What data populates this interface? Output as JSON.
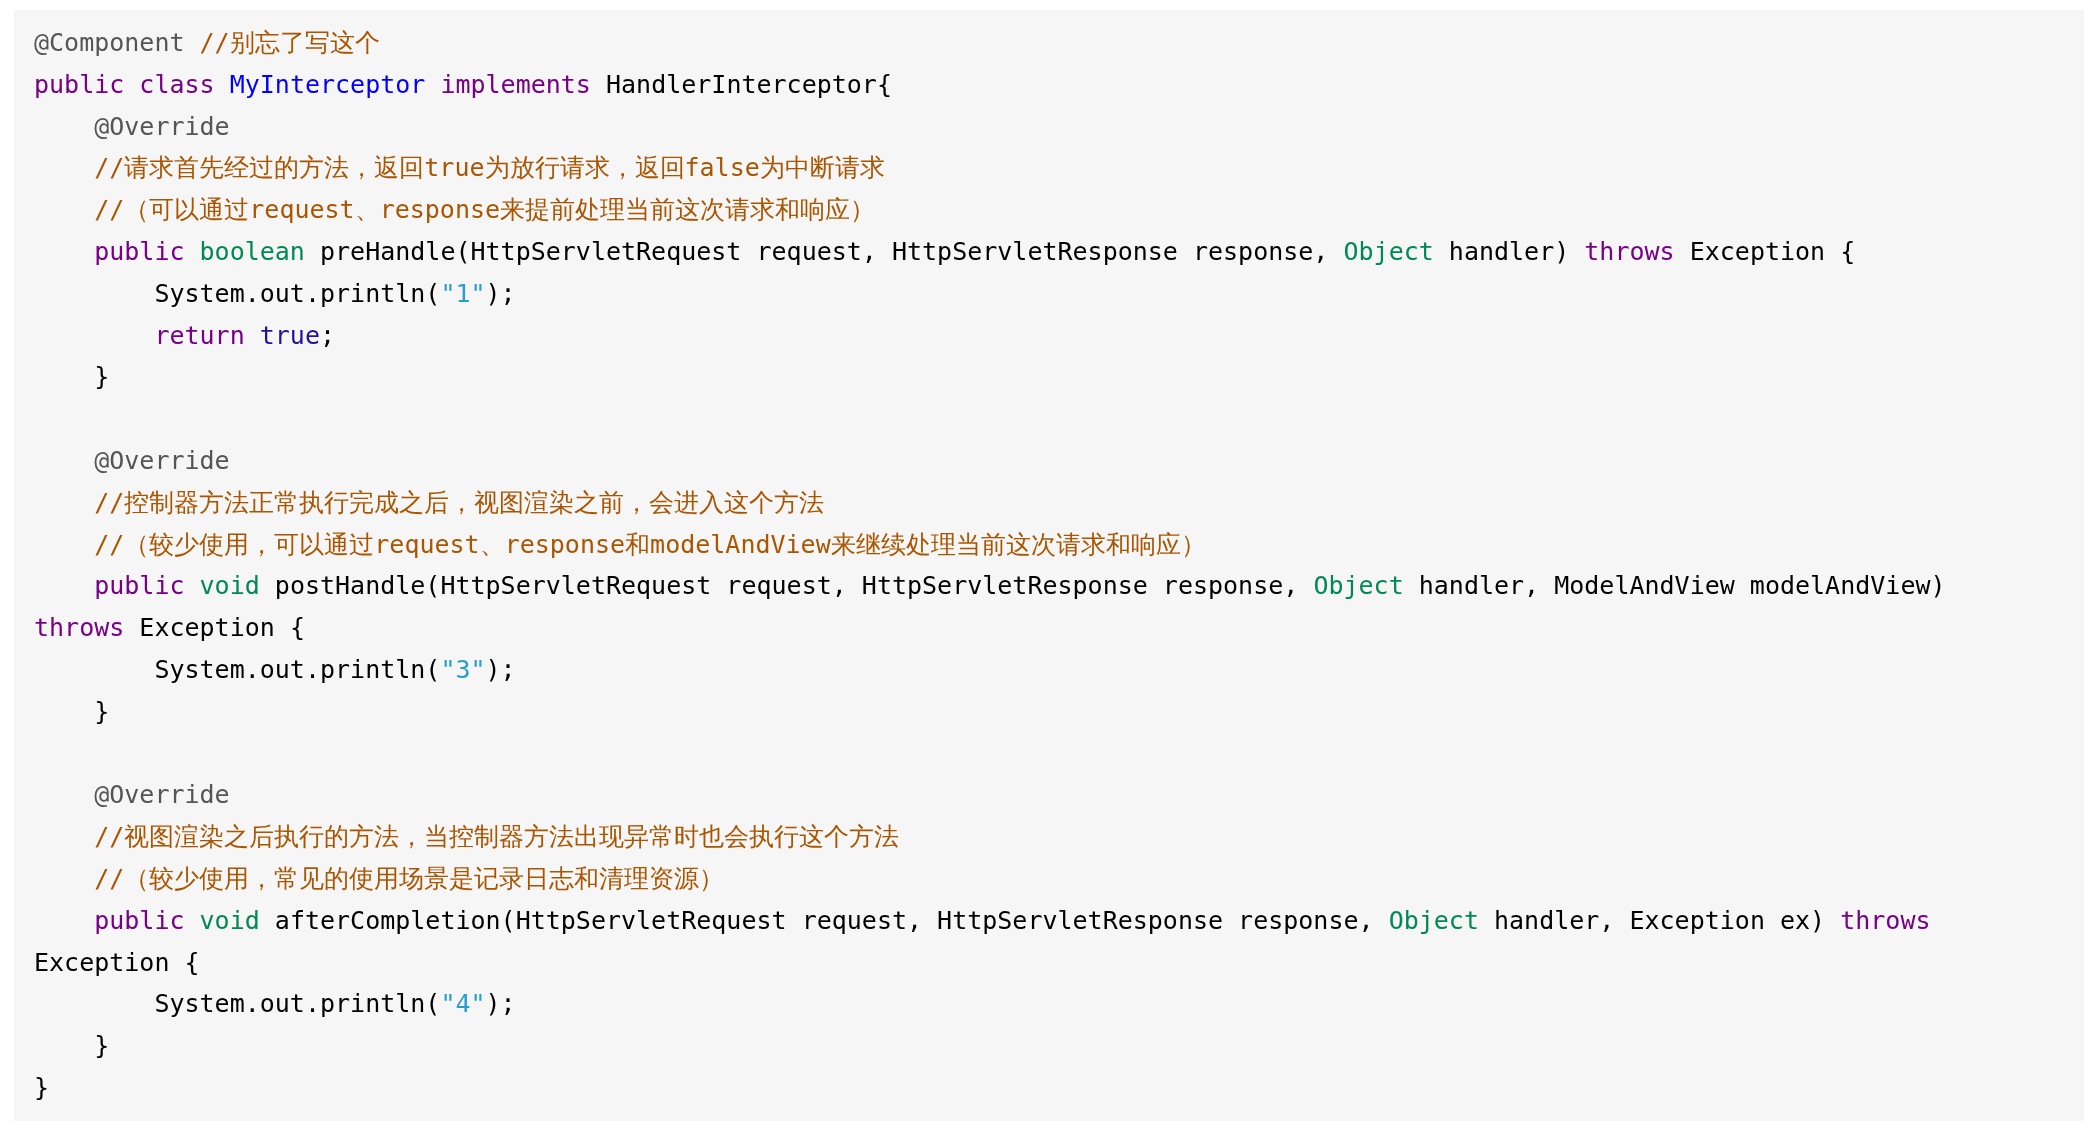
{
  "code_block": {
    "lines": [
      {
        "kind": "code",
        "tokens": [
          {
            "kind": "annotation",
            "text": "@Component"
          },
          {
            "kind": "comment",
            "text": " //别忘了写这个"
          }
        ]
      },
      {
        "kind": "code",
        "tokens": [
          {
            "kind": "keyword",
            "text": "public class"
          },
          {
            "kind": "classname",
            "text": " MyInterceptor"
          },
          {
            "kind": "keyword",
            "text": " implements"
          },
          {
            "kind": "plain",
            "text": " HandlerInterceptor{"
          }
        ]
      },
      {
        "kind": "code",
        "tokens": [
          {
            "kind": "annotation",
            "text": "    @Override"
          }
        ]
      },
      {
        "kind": "code",
        "tokens": [
          {
            "kind": "comment",
            "text": "    //请求首先经过的方法，返回true为放行请求，返回false为中断请求"
          }
        ]
      },
      {
        "kind": "code",
        "tokens": [
          {
            "kind": "comment",
            "text": "    //（可以通过request、response来提前处理当前这次请求和响应）"
          }
        ]
      },
      {
        "kind": "code",
        "tokens": [
          {
            "kind": "keyword",
            "text": "    public"
          },
          {
            "kind": "type",
            "text": " boolean"
          },
          {
            "kind": "plain",
            "text": " preHandle(HttpServletRequest request, HttpServletResponse response, "
          },
          {
            "kind": "type",
            "text": "Object"
          },
          {
            "kind": "plain",
            "text": " handler) "
          },
          {
            "kind": "keyword",
            "text": "throws"
          },
          {
            "kind": "plain",
            "text": " Exception {"
          }
        ]
      },
      {
        "kind": "code",
        "tokens": [
          {
            "kind": "plain",
            "text": "        System.out.println("
          },
          {
            "kind": "string",
            "text": "\"1\""
          },
          {
            "kind": "plain",
            "text": ");"
          }
        ]
      },
      {
        "kind": "code",
        "tokens": [
          {
            "kind": "keyword",
            "text": "        return"
          },
          {
            "kind": "literal",
            "text": " true"
          },
          {
            "kind": "plain",
            "text": ";"
          }
        ]
      },
      {
        "kind": "code",
        "tokens": [
          {
            "kind": "plain",
            "text": "    }"
          }
        ]
      },
      {
        "kind": "blank"
      },
      {
        "kind": "code",
        "tokens": [
          {
            "kind": "annotation",
            "text": "    @Override"
          }
        ]
      },
      {
        "kind": "code",
        "tokens": [
          {
            "kind": "comment",
            "text": "    //控制器方法正常执行完成之后，视图渲染之前，会进入这个方法"
          }
        ]
      },
      {
        "kind": "code",
        "tokens": [
          {
            "kind": "comment",
            "text": "    //（较少使用，可以通过request、response和modelAndView来继续处理当前这次请求和响应）"
          }
        ]
      },
      {
        "kind": "code",
        "tokens": [
          {
            "kind": "keyword",
            "text": "    public"
          },
          {
            "kind": "type",
            "text": " void"
          },
          {
            "kind": "plain",
            "text": " postHandle(HttpServletRequest request, HttpServletResponse response, "
          },
          {
            "kind": "type",
            "text": "Object"
          },
          {
            "kind": "plain",
            "text": " handler, ModelAndView modelAndView)"
          }
        ]
      },
      {
        "kind": "code",
        "tokens": [
          {
            "kind": "keyword",
            "text": "throws"
          },
          {
            "kind": "plain",
            "text": " Exception {"
          }
        ]
      },
      {
        "kind": "code",
        "tokens": [
          {
            "kind": "plain",
            "text": "        System.out.println("
          },
          {
            "kind": "string",
            "text": "\"3\""
          },
          {
            "kind": "plain",
            "text": ");"
          }
        ]
      },
      {
        "kind": "code",
        "tokens": [
          {
            "kind": "plain",
            "text": "    }"
          }
        ]
      },
      {
        "kind": "blank"
      },
      {
        "kind": "code",
        "tokens": [
          {
            "kind": "annotation",
            "text": "    @Override"
          }
        ]
      },
      {
        "kind": "code",
        "tokens": [
          {
            "kind": "comment",
            "text": "    //视图渲染之后执行的方法，当控制器方法出现异常时也会执行这个方法"
          }
        ]
      },
      {
        "kind": "code",
        "tokens": [
          {
            "kind": "comment",
            "text": "    //（较少使用，常见的使用场景是记录日志和清理资源）"
          }
        ]
      },
      {
        "kind": "code",
        "tokens": [
          {
            "kind": "keyword",
            "text": "    public"
          },
          {
            "kind": "type",
            "text": " void"
          },
          {
            "kind": "plain",
            "text": " afterCompletion(HttpServletRequest request, HttpServletResponse response, "
          },
          {
            "kind": "type",
            "text": "Object"
          },
          {
            "kind": "plain",
            "text": " handler, Exception ex) "
          },
          {
            "kind": "keyword",
            "text": "throws"
          }
        ]
      },
      {
        "kind": "code",
        "tokens": [
          {
            "kind": "plain",
            "text": "Exception {"
          }
        ]
      },
      {
        "kind": "code",
        "tokens": [
          {
            "kind": "plain",
            "text": "        System.out.println("
          },
          {
            "kind": "string",
            "text": "\"4\""
          },
          {
            "kind": "plain",
            "text": ");"
          }
        ]
      },
      {
        "kind": "code",
        "tokens": [
          {
            "kind": "plain",
            "text": "    }"
          }
        ]
      },
      {
        "kind": "code",
        "tokens": [
          {
            "kind": "plain",
            "text": "}"
          }
        ]
      }
    ]
  }
}
